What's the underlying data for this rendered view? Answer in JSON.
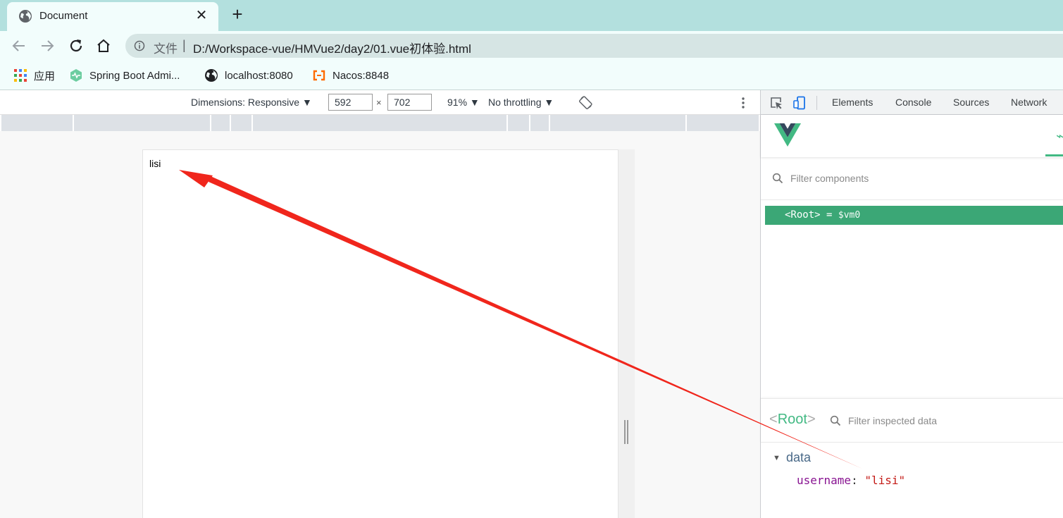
{
  "browser": {
    "tab": {
      "title": "Document"
    },
    "address": {
      "scheme_label": "文件",
      "separator": "|",
      "url": "D:/Workspace-vue/HMVue2/day2/01.vue初体验.html"
    },
    "bookmarks": [
      {
        "label": "应用"
      },
      {
        "label": "Spring Boot Admi..."
      },
      {
        "label": "localhost:8080"
      },
      {
        "label": "Nacos:8848"
      }
    ]
  },
  "device_toolbar": {
    "dimensions_label": "Dimensions: Responsive ▼",
    "width": "592",
    "times": "×",
    "height": "702",
    "zoom": "91% ▼",
    "throttling": "No throttling ▼"
  },
  "page": {
    "text": "lisi"
  },
  "devtools": {
    "tabs": [
      {
        "label": "Elements"
      },
      {
        "label": "Console"
      },
      {
        "label": "Sources"
      },
      {
        "label": "Network"
      }
    ],
    "vue": {
      "filter_components_placeholder": "Filter components",
      "root_row": {
        "label": "<Root>",
        "assign": " = ",
        "vm": "$vm0"
      },
      "inspector": {
        "root_open": "<",
        "root_name": "Root",
        "root_close": ">",
        "filter_placeholder": "Filter inspected data",
        "section": "data",
        "prop_key": "username",
        "prop_colon": ": ",
        "prop_value": "\"lisi\""
      }
    }
  },
  "colors": {
    "vue_green": "#42b983",
    "arrow_red": "#f0261c",
    "tabstrip": "#b3e0de"
  }
}
